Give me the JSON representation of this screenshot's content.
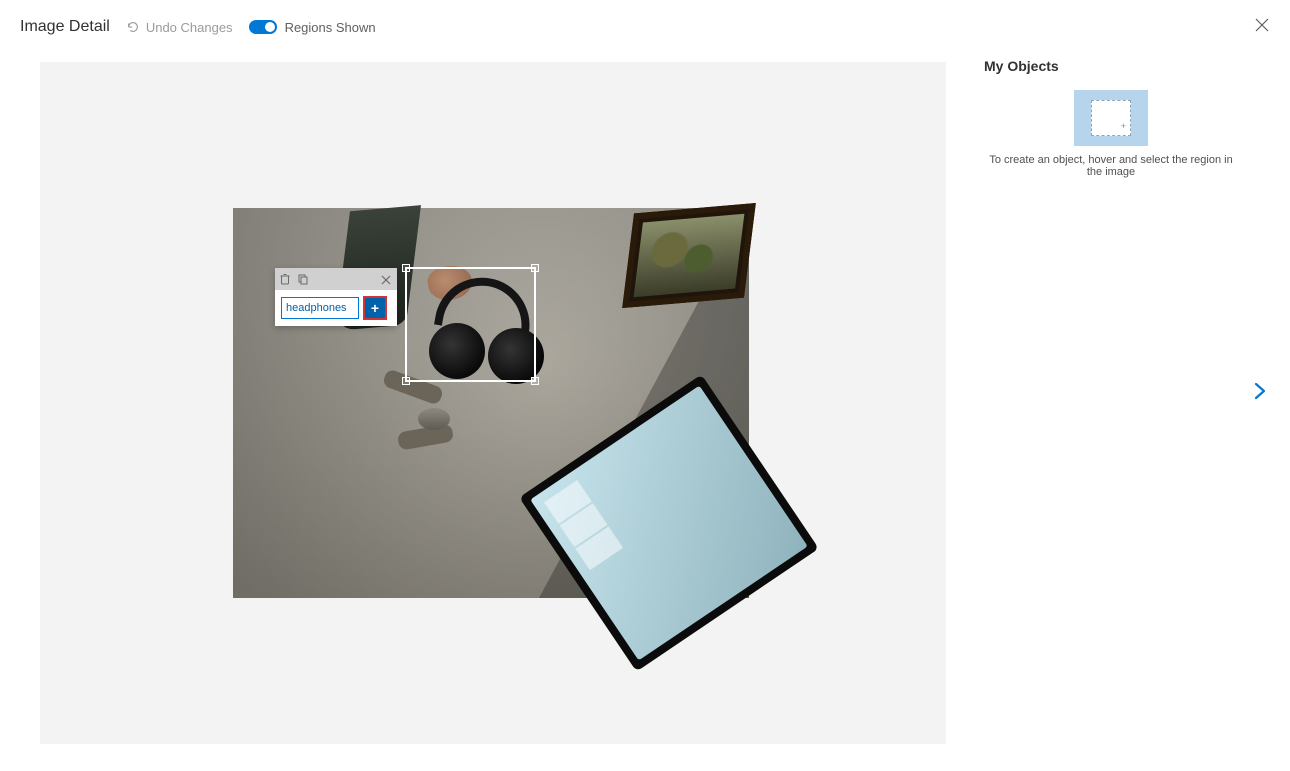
{
  "header": {
    "title": "Image Detail",
    "undo_label": "Undo Changes",
    "toggle_label": "Regions Shown"
  },
  "tag_popup": {
    "input_value": "headphones",
    "add_label": "+"
  },
  "right_panel": {
    "title": "My Objects",
    "hint": "To create an object, hover and select the region in the image"
  }
}
